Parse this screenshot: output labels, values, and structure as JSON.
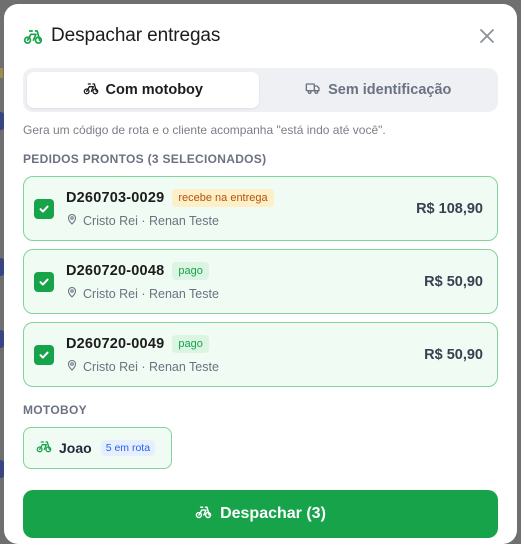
{
  "modal": {
    "title": "Despachar entregas",
    "icon": "bike-icon",
    "close_icon": "close-icon"
  },
  "tabs": [
    {
      "label": "Com motoboy",
      "icon": "bike-icon",
      "active": true
    },
    {
      "label": "Sem identificação",
      "icon": "truck-icon",
      "active": false
    }
  ],
  "hint": "Gera um código de rota e o cliente acompanha \"está indo até você\".",
  "orders_section": {
    "title": "PEDIDOS PRONTOS (3 SELECIONADOS)",
    "orders": [
      {
        "id": "D260703-0029",
        "badge": "recebe na entrega",
        "badge_type": "warn",
        "location": "Cristo Rei · Renan Teste",
        "price": "R$ 108,90",
        "checked": true
      },
      {
        "id": "D260720-0048",
        "badge": "pago",
        "badge_type": "paid",
        "location": "Cristo Rei · Renan Teste",
        "price": "R$ 50,90",
        "checked": true
      },
      {
        "id": "D260720-0049",
        "badge": "pago",
        "badge_type": "paid",
        "location": "Cristo Rei · Renan Teste",
        "price": "R$ 50,90",
        "checked": true
      }
    ]
  },
  "motoboy_section": {
    "title": "MOTOBOY",
    "name": "Joao",
    "count": "5 em rota"
  },
  "dispatch_button": {
    "label": "Despachar (3)"
  },
  "colors": {
    "accent": "#16a34a",
    "border": "#7fd49a",
    "selected_bg": "#f0fbf3"
  }
}
